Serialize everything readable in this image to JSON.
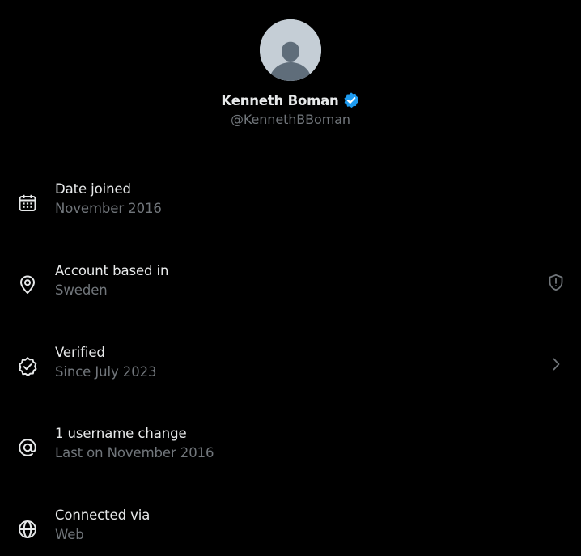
{
  "profile": {
    "display_name": "Kenneth Boman",
    "handle": "@KennethBBoman",
    "verified": true,
    "badge_color": "#1d9bf0"
  },
  "about": [
    {
      "icon": "calendar-icon",
      "title": "Date joined",
      "subtitle": "November 2016"
    },
    {
      "icon": "location-pin-icon",
      "title": "Account based in",
      "subtitle": "Sweden",
      "trailing_icon": "shield-alert-icon"
    },
    {
      "icon": "verified-check-icon",
      "title": "Verified",
      "subtitle": "Since July 2023",
      "trailing_icon": "chevron-right-icon"
    },
    {
      "icon": "at-sign-icon",
      "title": "1 username change",
      "subtitle": "Last on November 2016"
    },
    {
      "icon": "globe-icon",
      "title": "Connected via",
      "subtitle": "Web"
    }
  ],
  "colors": {
    "background": "#000000",
    "primary_text": "#e7e9ea",
    "secondary_text": "#71767b",
    "accent": "#1d9bf0"
  }
}
